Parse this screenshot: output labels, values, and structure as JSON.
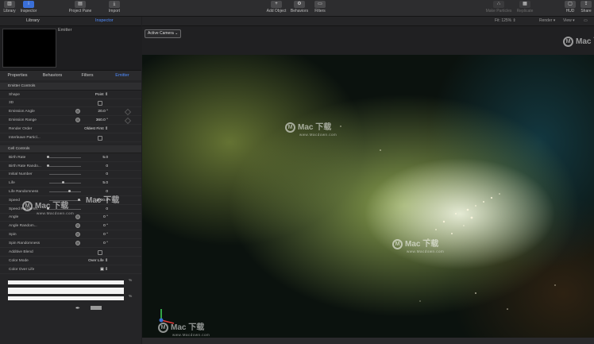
{
  "toolbar": {
    "library": "Library",
    "inspector": "Inspector",
    "project_pane": "Project Pane",
    "import": "Import",
    "add_object": "Add Object",
    "behaviors": "Behaviors",
    "filters": "Filters",
    "make_particles": "Make Particles",
    "replicate": "Replicate",
    "hud": "HUD",
    "share": "Share"
  },
  "left_tabs": {
    "library": "Library",
    "inspector": "Inspector"
  },
  "layer_name": "Emitter",
  "inspector_tabs": [
    "Properties",
    "Behaviors",
    "Filters",
    "Emitter"
  ],
  "viewer": {
    "fit": "Fit: 125% ⇕",
    "render": "Render ▾",
    "view": "View ▾",
    "camera": "Active Camera ⌄"
  },
  "emitter_controls": {
    "header": "Emitter Controls",
    "rows": [
      {
        "label": "Shape",
        "value": "Point ⇕"
      },
      {
        "label": "3D",
        "value": ""
      },
      {
        "label": "Emission Angle",
        "value": "20.0 °"
      },
      {
        "label": "Emission Range",
        "value": "360.0 °"
      },
      {
        "label": "Render Order",
        "value": "Oldest First ⇕"
      },
      {
        "label": "Interleave Particl...",
        "value": ""
      }
    ]
  },
  "cell_controls": {
    "header": "Cell Controls",
    "rows": [
      {
        "label": "Birth Rate",
        "value": "5.0"
      },
      {
        "label": "Birth Rate Rando...",
        "value": "0"
      },
      {
        "label": "Initial Number",
        "value": "0"
      },
      {
        "label": "Life",
        "value": "5.0"
      },
      {
        "label": "Life Randomness",
        "value": "0"
      },
      {
        "label": "Speed",
        "value": "2000.0"
      },
      {
        "label": "Speed Randomn...",
        "value": "0"
      },
      {
        "label": "Angle",
        "value": "0 °"
      },
      {
        "label": "Angle Random...",
        "value": "0 °"
      },
      {
        "label": "Spin",
        "value": "0 °"
      },
      {
        "label": "Spin Randomness",
        "value": "0 °"
      },
      {
        "label": "Additive Blend",
        "value": ""
      },
      {
        "label": "Color Mode",
        "value": "Over Life ⇕"
      },
      {
        "label": "Color Over Life",
        "value": ""
      }
    ]
  },
  "gradient_percent": "%",
  "watermark": {
    "brand": "Mac 下载",
    "url": "www.Macdown.com"
  },
  "colors": {
    "accent": "#4f8cff",
    "panel": "#252527"
  }
}
